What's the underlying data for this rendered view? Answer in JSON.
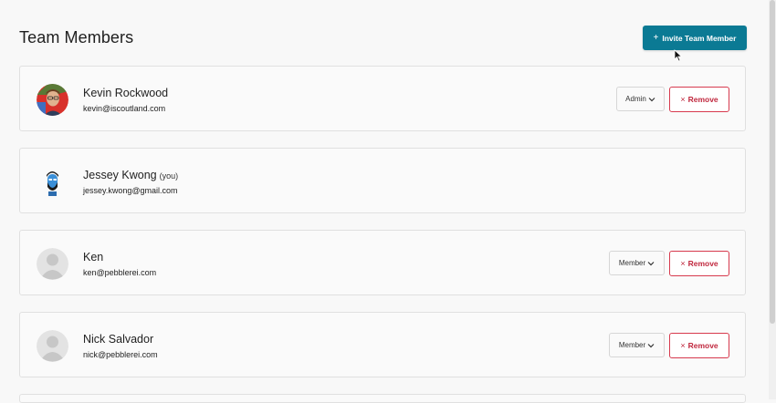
{
  "page": {
    "title": "Team Members",
    "invite_button": {
      "icon": "plus-icon",
      "label": "Invite Team Member"
    }
  },
  "members": [
    {
      "name": "Kevin Rockwood",
      "you_tag": "",
      "email": "kevin@iscoutland.com",
      "avatar": "photo",
      "role": "Admin",
      "remove_label": "Remove",
      "can_manage": true
    },
    {
      "name": "Jessey Kwong",
      "you_tag": "(you)",
      "email": "jessey.kwong@gmail.com",
      "avatar": "illustration",
      "role": "",
      "remove_label": "",
      "can_manage": false
    },
    {
      "name": "Ken",
      "you_tag": "",
      "email": "ken@pebblerei.com",
      "avatar": "default",
      "role": "Member",
      "remove_label": "Remove",
      "can_manage": true
    },
    {
      "name": "Nick Salvador",
      "you_tag": "",
      "email": "nick@pebblerei.com",
      "avatar": "default",
      "role": "Member",
      "remove_label": "Remove",
      "can_manage": true
    }
  ],
  "colors": {
    "primary": "#0b7a94",
    "danger": "#c0283e",
    "background": "#f8f8f8",
    "card_border": "#e0e0e0"
  }
}
